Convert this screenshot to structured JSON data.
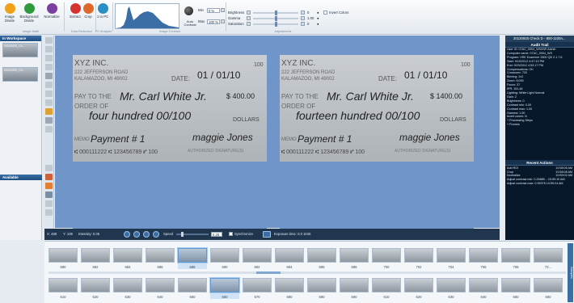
{
  "ribbon": {
    "buttons": [
      {
        "label": "Image Divide",
        "icon": "image-divide-icon",
        "color": "#f0a11a"
      },
      {
        "label": "Background Divide",
        "icon": "background-divide-icon",
        "color": "#2f9a3c"
      },
      {
        "label": "Normalize",
        "icon": "normalize-icon",
        "color": "#7b3fa0"
      },
      {
        "label": "Extract",
        "icon": "extract-icon",
        "color": "#d6332f"
      },
      {
        "label": "Crop",
        "icon": "crop-icon",
        "color": "#e0672a"
      },
      {
        "label": "1 to PC",
        "icon": "pc-icon",
        "color": "#2a8fc4"
      }
    ],
    "groups": {
      "image_math": "Image Math",
      "data_reduction": "Data Reduction",
      "pc_analysis": "PC Analysis",
      "image_contrast": "Image Contrast",
      "adjustments": "Adjustments"
    },
    "contrast": {
      "auto_label": "Auto Contrast",
      "min_label": "Min",
      "min_value": "0 %",
      "max_label": "Max",
      "max_value": "100 %"
    },
    "adjust": {
      "brightness_label": "Brightness",
      "brightness_value": "0",
      "gamma_label": "Gamma",
      "gamma_value": "1.00",
      "saturation_label": "Saturation",
      "saturation_value": "0",
      "invert_label": "Invert Colors"
    }
  },
  "workspace": {
    "title": "In Workspace",
    "items": [
      "20120920_Ch...",
      "20120920_Ch..."
    ],
    "available_title": "Available"
  },
  "check_left": {
    "company": "XYZ INC.",
    "address1": "222 JEFFERSON ROAD",
    "address2": "KALAMAZOO, MI 49002",
    "date_label": "DATE:",
    "date": "01 / 01/10",
    "pay_label": "PAY TO THE",
    "order_label": "ORDER OF",
    "payee": "Mr. Carl White Jr.",
    "amount": "$ 400.00",
    "words": "four hundred 00/100",
    "dollars": "DOLLARS",
    "memo_label": "MEMO",
    "memo": "Payment # 1",
    "signature": "maggie Jones",
    "sig_label": "AUTHORIZED SIGNATURE(S)",
    "micr": "⑆ 000111222 ⑆ 123456789 ⑈ 100",
    "number": "100"
  },
  "check_right": {
    "company": "XYZ INC.",
    "address1": "222 JEFFERSON ROAD",
    "address2": "KALAMAZOO, MI 49002",
    "date_label": "DATE:",
    "date": "01 / 01/10",
    "pay_label": "PAY TO THE",
    "order_label": "ORDER OF",
    "payee": "Mr. Carl White Jr.",
    "amount": "$ 1400.00",
    "words": "fourteen hundred 00/100",
    "dollars": "DOLLARS",
    "memo_label": "MEMO",
    "memo": "Payment # 1",
    "signature": "maggie Jones",
    "sig_label": "AUTHORIZED SIGNATURE(S)",
    "micr": "⑆ 000111222 ⑆ 123456789 ⑈ 100",
    "number": "100"
  },
  "playbar": {
    "x": "X: 488",
    "y": "Y: 108",
    "intensity": "Intensity: 0.05",
    "speed_label": "Speed",
    "speed_value": "0.25",
    "sync_label": "Synchronize",
    "exposure": "Exposure time: 0.0 1045"
  },
  "audit": {
    "window_title": "20120920 Check D - 800-1100n...",
    "title": "Audit Trail",
    "lines": [
      "User ID: 07AC_0004_WS\\ISR Admin",
      "Computer name: 07AC_0004_WS",
      "Program: HSE Examiner 2600 QD 2.1.7.6",
      "Start: 9/10/2012 4:47:13 PM",
      "End: 9/20/2012 4:53:17 PM",
      "Compensations: On",
      "Crossover: 720",
      "Binning: 2x2",
      "Zoom: 8,000",
      "Focus: 37",
      "IPR: 151.46",
      "Lighting: White Light Normal",
      "Gain: 2",
      "Brightness: 0",
      "Contrast min: 0.00",
      "Contrast max: 1.00",
      "Gamma: 1.00",
      "Invert colors: N",
      "+ Processing Steps",
      "+ Frames"
    ],
    "recent_title": "Recent Actions",
    "recent": [
      {
        "action": "Add ROI",
        "time": "10:58:06 AM"
      },
      {
        "action": "Crop",
        "time": "10:58:08 AM"
      },
      {
        "action": "Normalize",
        "time": "10:59:02 AM"
      },
      {
        "action": "Adjust contrast min: 0.25885... 10:59:10 AM",
        "time": ""
      },
      {
        "action": "Adjust contrast max: 0.99978 10:59:24 AM",
        "time": ""
      }
    ]
  },
  "filmstrip": {
    "row1": [
      "680",
      "682",
      "684",
      "686",
      "688",
      "690",
      "692",
      "694",
      "696",
      "698",
      "700",
      "702",
      "704",
      "706",
      "708",
      "72..."
    ],
    "row1_selected": 4,
    "row2": [
      "510",
      "520",
      "530",
      "540",
      "550",
      "560",
      "570",
      "580",
      "590",
      "600",
      "610",
      "620",
      "630",
      "640",
      "650",
      "660"
    ],
    "row2_selected": 5,
    "side_label": "Samples"
  }
}
